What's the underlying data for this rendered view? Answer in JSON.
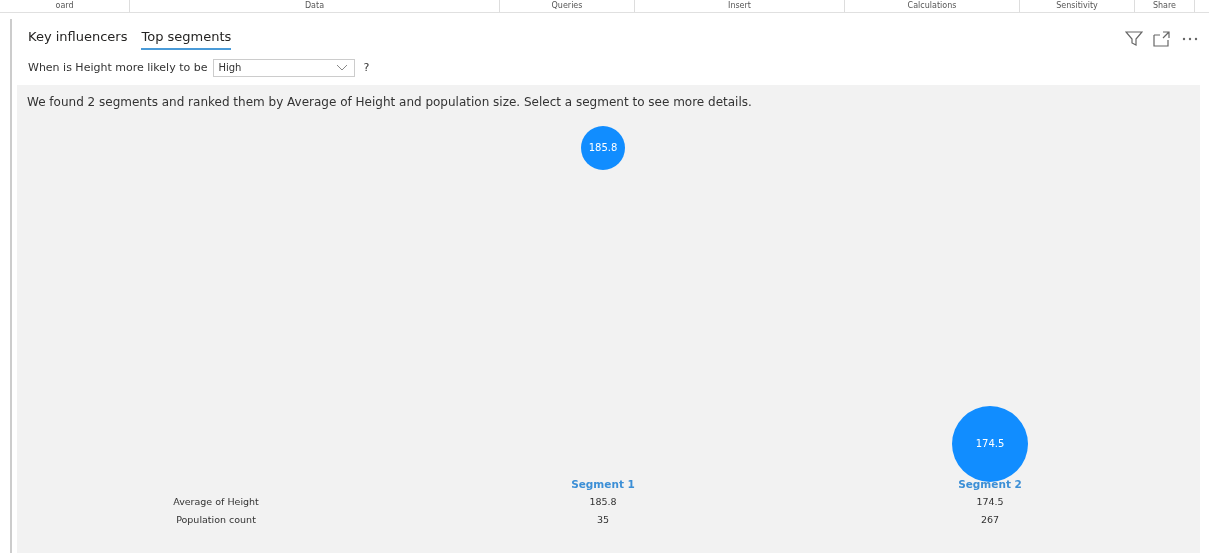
{
  "ribbon_tabs": [
    "oard",
    "Data",
    "Queries",
    "Insert",
    "Calculations",
    "Sensitivity",
    "Share"
  ],
  "tabs": [
    {
      "label": "Key influencers",
      "selected": false
    },
    {
      "label": "Top segments",
      "selected": true
    }
  ],
  "question": {
    "prefix": "When is Height more likely to be",
    "value": "High",
    "suffix": "?"
  },
  "message": "We found 2 segments and ranked them by Average of Height and population size. Select a segment to see more details.",
  "row_labels": [
    "Average of Height",
    "Population count"
  ],
  "segments": [
    {
      "name": "Segment 1",
      "bubble_label": "185.8",
      "average": "185.8",
      "population": "35"
    },
    {
      "name": "Segment 2",
      "bubble_label": "174.5",
      "average": "174.5",
      "population": "267"
    }
  ]
}
